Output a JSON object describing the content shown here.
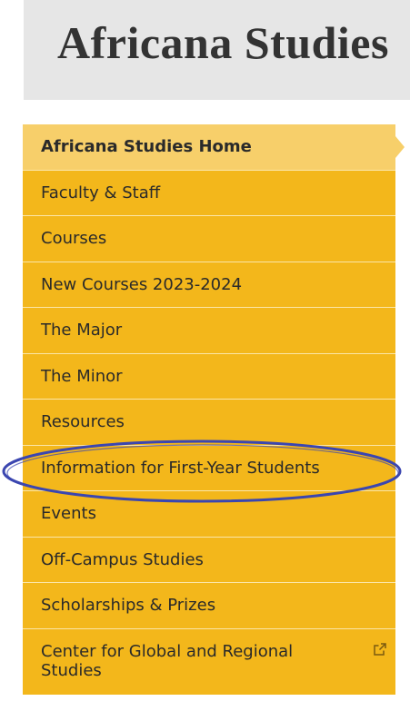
{
  "header": {
    "title": "Africana Studies"
  },
  "nav": {
    "items": [
      {
        "label": "Africana Studies Home",
        "active": true
      },
      {
        "label": "Faculty & Staff"
      },
      {
        "label": "Courses"
      },
      {
        "label": "New Courses 2023-2024"
      },
      {
        "label": "The Major"
      },
      {
        "label": "The Minor"
      },
      {
        "label": "Resources"
      },
      {
        "label": "Information for First-Year Students",
        "highlighted": true
      },
      {
        "label": "Events"
      },
      {
        "label": "Off-Campus Studies"
      },
      {
        "label": "Scholarships & Prizes"
      },
      {
        "label": "Center for Global and Regional Studies",
        "external": true,
        "icon": "external-link-icon"
      }
    ]
  },
  "colors": {
    "nav_background": "#f3b71b",
    "nav_active_background": "#f7cf6a",
    "header_background": "#e6e6e6",
    "annotation_ellipse": "#3b46b0"
  }
}
